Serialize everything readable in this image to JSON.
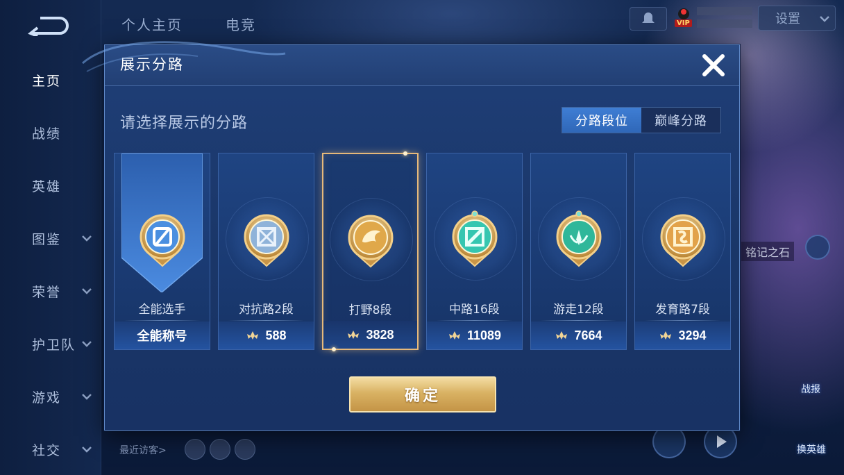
{
  "sidebar": {
    "items": [
      {
        "label": "主页",
        "active": true,
        "has_chevron": false
      },
      {
        "label": "战绩",
        "active": false,
        "has_chevron": false
      },
      {
        "label": "英雄",
        "active": false,
        "has_chevron": false
      },
      {
        "label": "图鉴",
        "active": false,
        "has_chevron": true
      },
      {
        "label": "荣誉",
        "active": false,
        "has_chevron": true
      },
      {
        "label": "护卫队",
        "active": false,
        "has_chevron": true
      },
      {
        "label": "游戏",
        "active": false,
        "has_chevron": true
      },
      {
        "label": "社交",
        "active": false,
        "has_chevron": true
      }
    ]
  },
  "top_bar": {
    "tabs": [
      "个人主页",
      "电竞"
    ],
    "settings_label": "设置",
    "vip_badge": "VIP"
  },
  "background": {
    "recent_visitors_label": "最近访客>",
    "stone_label": "铭记之石",
    "right_buttons": [
      "战报",
      "换英雄"
    ]
  },
  "dialog": {
    "title": "展示分路",
    "subtitle": "请选择展示的分路",
    "toggle": {
      "options": [
        "分路段位",
        "巅峰分路"
      ],
      "selected": 0
    },
    "confirm_label": "确定",
    "selected_index": 2,
    "cards": [
      {
        "name": "全能选手",
        "value": "全能称号",
        "emblem": "all-round-emblem-icon",
        "accent": "#4a8fe0"
      },
      {
        "name": "对抗路2段",
        "value": "588",
        "emblem": "clash-lane-emblem-icon",
        "accent": "#8fb3d9"
      },
      {
        "name": "打野8段",
        "value": "3828",
        "emblem": "jungle-emblem-icon",
        "accent": "#e0a84a"
      },
      {
        "name": "中路16段",
        "value": "11089",
        "emblem": "mid-lane-emblem-icon",
        "accent": "#35c6b0"
      },
      {
        "name": "游走12段",
        "value": "7664",
        "emblem": "roam-emblem-icon",
        "accent": "#2fb79a"
      },
      {
        "name": "发育路7段",
        "value": "3294",
        "emblem": "farm-lane-emblem-icon",
        "accent": "#e2a24a"
      }
    ]
  },
  "colors": {
    "dialog_bg": "#1f3f78",
    "selected_border": "#e6b97a",
    "toggle_active": "#3f7ed4",
    "confirm_gold": "#d9b263"
  }
}
